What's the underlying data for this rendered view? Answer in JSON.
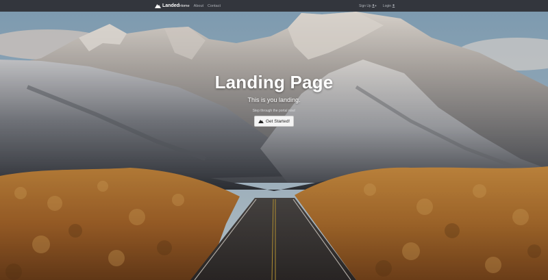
{
  "navbar": {
    "brand": {
      "label": "Landed",
      "icon": "mountain-icon"
    },
    "links": [
      {
        "label": "Home",
        "active": true
      },
      {
        "label": "About",
        "active": false
      },
      {
        "label": "Contact",
        "active": false
      }
    ],
    "signup": {
      "label": "Sign Up",
      "icon": "user-plus-icon"
    },
    "login": {
      "label": "Login",
      "icon": "user-icon"
    }
  },
  "hero": {
    "title": "Landing Page",
    "subtitle": "This is you landing.",
    "hint": "Step through the portal now!",
    "cta": {
      "label": "Get Started!",
      "icon": "mountain-icon"
    }
  },
  "colors": {
    "navbar_bg": "#33363d",
    "nav_active": "#ffffff",
    "nav_inactive": "#aeb2b8",
    "cta_bg": "#f4f4f4"
  }
}
